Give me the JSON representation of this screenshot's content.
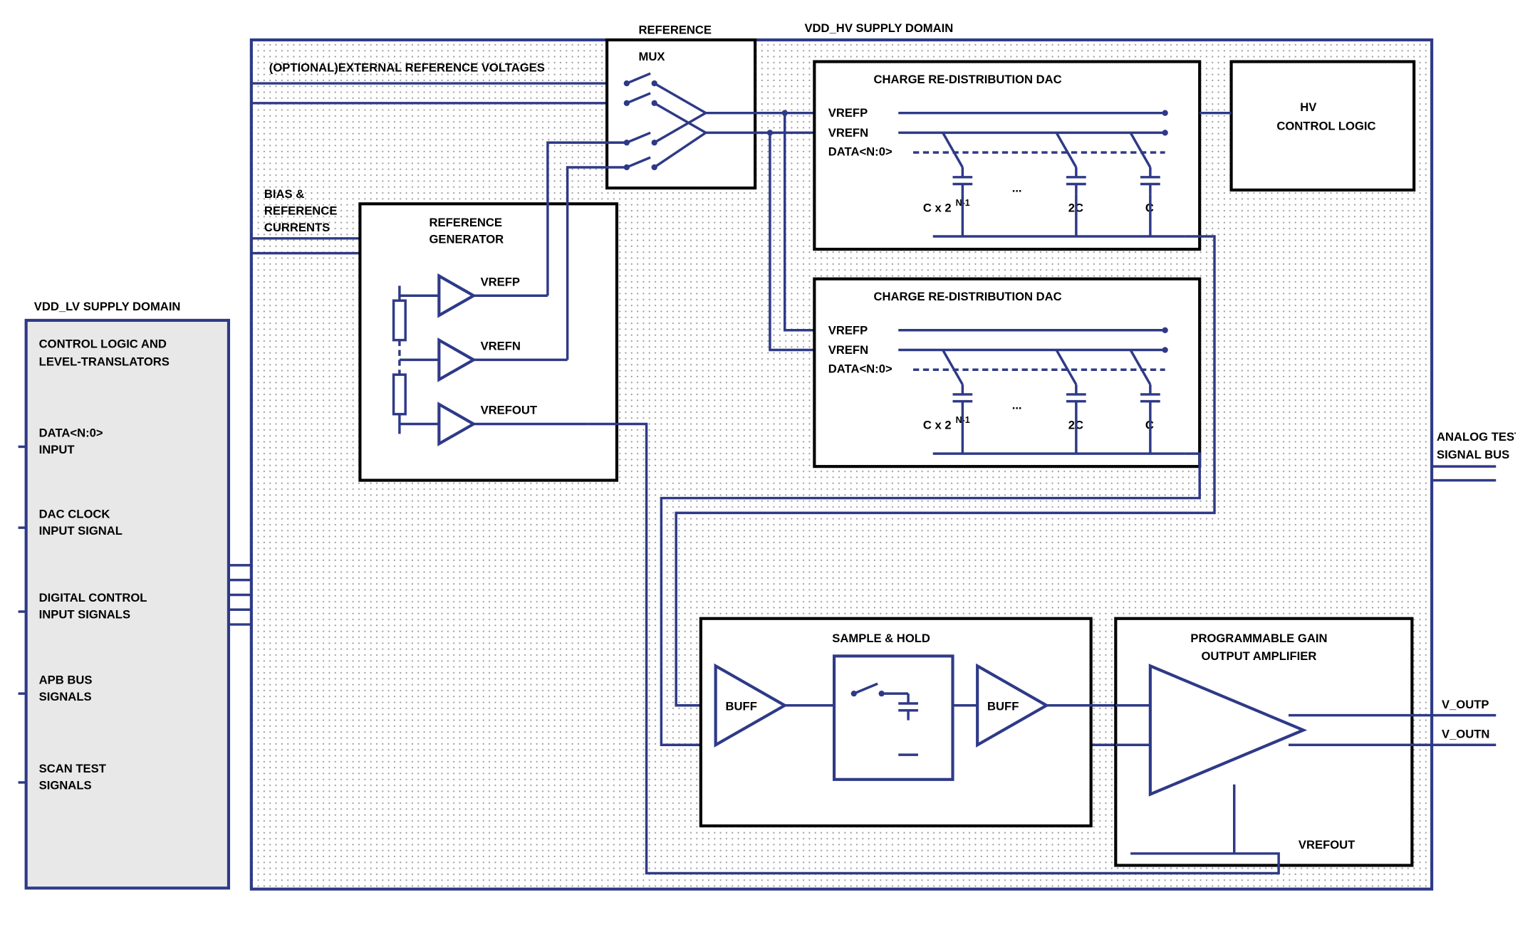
{
  "hv_domain_title": "VDD_HV SUPPLY DOMAIN",
  "lv_domain_title": "VDD_LV SUPPLY DOMAIN",
  "lv_block_header1": "CONTROL LOGIC AND",
  "lv_block_header2": "LEVEL-TRANSLATORS",
  "lv_inputs": {
    "data": "DATA<N:0>\nINPUT",
    "clock": "DAC CLOCK\nINPUT SIGNAL",
    "digital": "DIGITAL CONTROL\nINPUT SIGNALS",
    "apb": "APB BUS\nSIGNALS",
    "scan": "SCAN TEST\nSIGNALS"
  },
  "hv_labels": {
    "ext_ref": "(OPTIONAL)EXTERNAL REFERENCE VOLTAGES",
    "bias": "BIAS &\nREFERENCE\nCURRENTS",
    "refmux": "REFERENCE\nMUX",
    "refgen": "REFERENCE\nGENERATOR",
    "vrefp": "VREFP",
    "vrefn": "VREFN",
    "vrefout": "VREFOUT",
    "dac_title": "CHARGE RE-DISTRIBUTION DAC",
    "dac_vrefp": "VREFP",
    "dac_vrefn": "VREFN",
    "dac_data": "DATA<N:0>",
    "cap_big": "C x 2",
    "cap_big_sup": "N-1",
    "cap_2c": "2C",
    "cap_c": "C",
    "cap_dots": "...",
    "hv_ctrl": "HV\nCONTROL LOGIC",
    "sh": "SAMPLE & HOLD",
    "buff": "BUFF",
    "pga": "PROGRAMMABLE GAIN\nOUTPUT AMPLIFIER",
    "analog_test": "ANALOG TEST\nSIGNAL BUS",
    "voutp": "V_OUTP",
    "voutn": "V_OUTN"
  }
}
